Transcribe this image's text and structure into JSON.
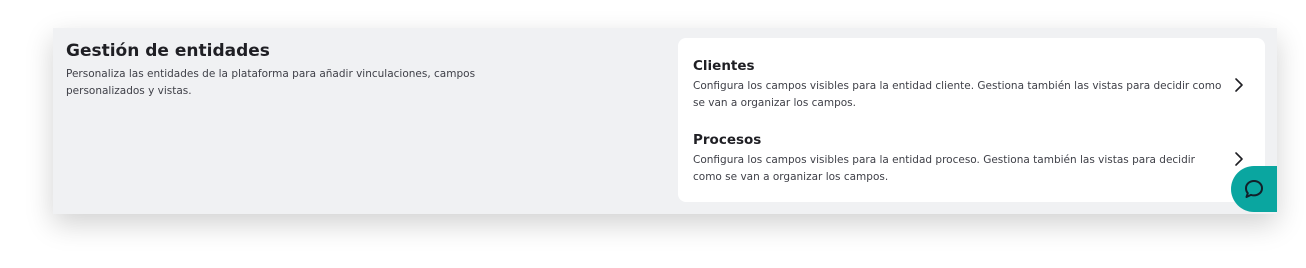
{
  "section": {
    "title": "Gestión de entidades",
    "description": "Personaliza las entidades de la plataforma para añadir vinculaciones, campos personalizados y vistas."
  },
  "entities": [
    {
      "title": "Clientes",
      "description": "Configura los campos visibles para la entidad cliente. Gestiona también las vistas para decidir como se van a organizar los campos.",
      "icon": "chevron-right-icon"
    },
    {
      "title": "Procesos",
      "description": "Configura los campos visibles para la entidad proceso. Gestiona también las vistas para decidir como se van a organizar los campos.",
      "icon": "chevron-right-icon"
    }
  ],
  "chat_widget": {
    "icon": "chat-bubble-icon",
    "color": "#0aa6a0"
  }
}
